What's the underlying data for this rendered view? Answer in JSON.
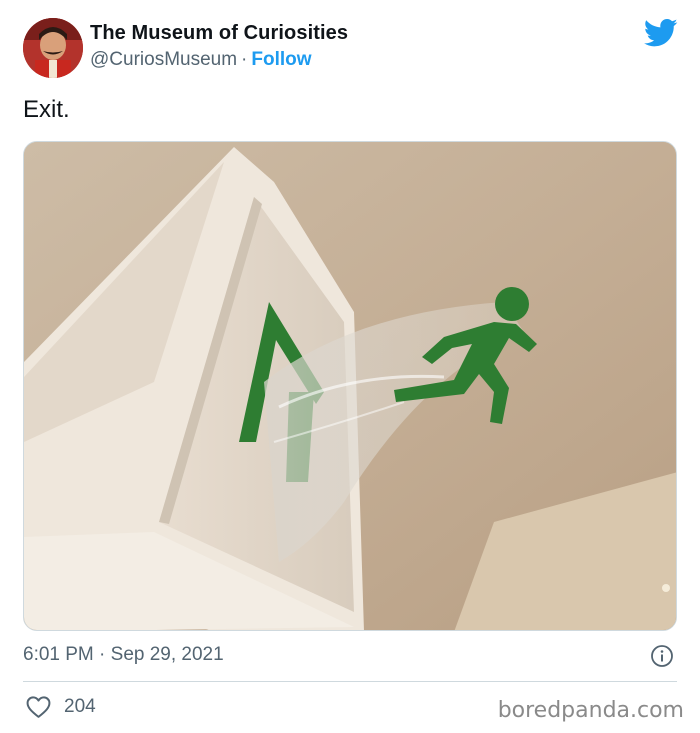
{
  "tweet": {
    "author": {
      "display_name": "The Museum of Curiosities",
      "handle": "@CuriosMuseum",
      "separator": "·",
      "follow_label": "Follow"
    },
    "text": "Exit.",
    "timestamp": "6:01 PM · Sep 29, 2021",
    "like_count": "204"
  },
  "watermark": "boredpanda.com",
  "icons": {
    "brand": "twitter-bird-icon",
    "info": "info-icon",
    "like": "heart-icon"
  },
  "colors": {
    "accent": "#1d9bf0",
    "secondary_text": "#536471",
    "primary_text": "#0f1419",
    "divider": "#cfd9de",
    "exit_sign_green": "#2e7d32"
  }
}
